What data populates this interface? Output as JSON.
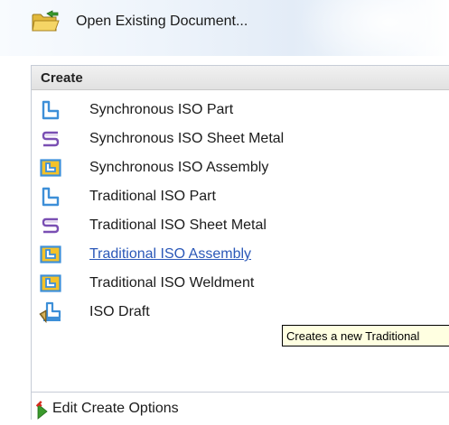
{
  "open_existing": {
    "label": "Open Existing Document...",
    "icon": "folder-open-icon"
  },
  "create": {
    "header": "Create",
    "items": [
      {
        "label": "Synchronous ISO Part",
        "icon": "part-icon"
      },
      {
        "label": "Synchronous ISO Sheet Metal",
        "icon": "sheet-metal-icon"
      },
      {
        "label": "Synchronous ISO Assembly",
        "icon": "assembly-icon"
      },
      {
        "label": "Traditional ISO Part",
        "icon": "part-icon"
      },
      {
        "label": "Traditional ISO Sheet Metal",
        "icon": "sheet-metal-icon"
      },
      {
        "label": "Traditional ISO Assembly",
        "icon": "assembly-icon"
      },
      {
        "label": "Traditional ISO Weldment",
        "icon": "weldment-icon"
      },
      {
        "label": "ISO Draft",
        "icon": "draft-icon"
      }
    ]
  },
  "tooltip": {
    "text": "Creates a new Traditional"
  },
  "edit_options": {
    "label": "Edit Create Options",
    "icon": "edit-options-icon"
  },
  "colors": {
    "link_hover": "#2b58b8",
    "tooltip_bg": "#ffffe1",
    "part_blue": "#3d8fd8",
    "sheet_metal_purple": "#7a4fb3",
    "assembly_yellow": "#f3c22a"
  }
}
